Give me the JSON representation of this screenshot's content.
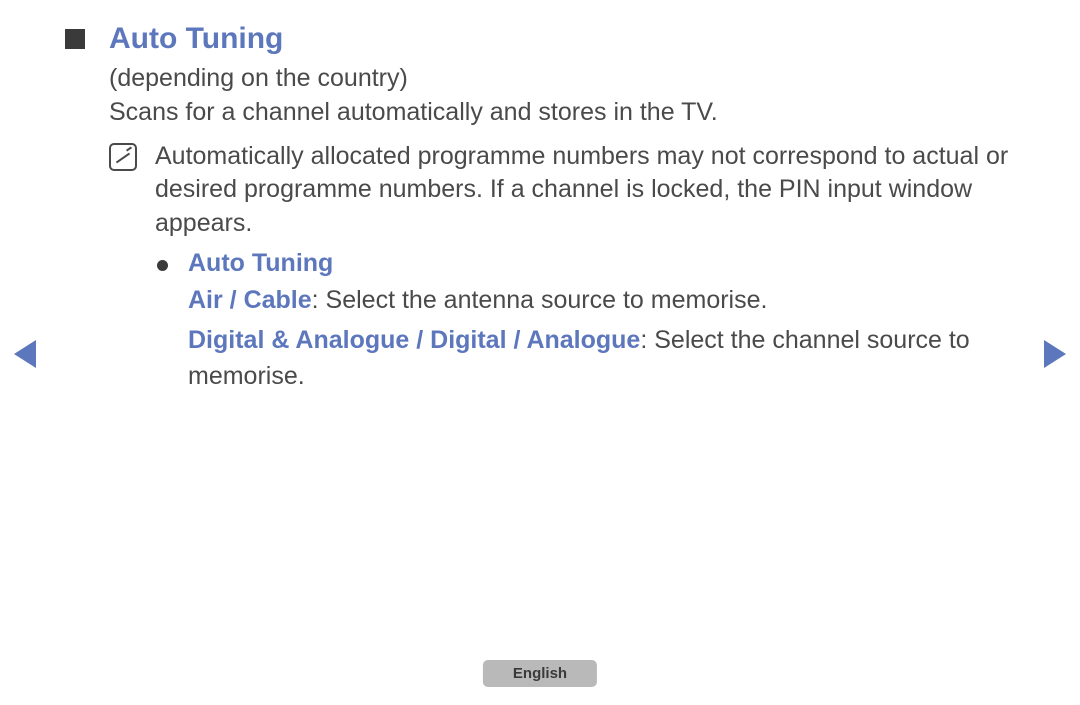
{
  "title": "Auto Tuning",
  "subtitle": "(depending on the country)",
  "description": "Scans for a channel automatically and stores in the TV.",
  "note": "Automatically allocated programme numbers may not correspond to actual or desired programme numbers. If a channel is locked, the PIN input window appears.",
  "sub_section_title": "Auto Tuning",
  "option1_label": "Air / Cable",
  "option1_desc": ": Select the antenna source to memorise.",
  "option2_label": "Digital & Analogue / Digital / Analogue",
  "option2_desc": ": Select the channel source to memorise.",
  "language": "English"
}
